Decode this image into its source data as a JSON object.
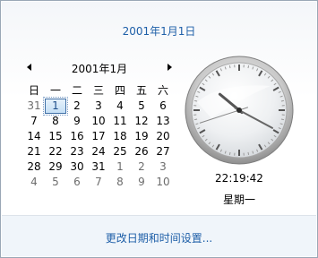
{
  "header": {
    "date": "2001年1月1日"
  },
  "calendar": {
    "month_label": "2001年1月",
    "weekdays": [
      "日",
      "一",
      "二",
      "三",
      "四",
      "五",
      "六"
    ],
    "weeks": [
      [
        {
          "d": "31",
          "o": true
        },
        {
          "d": "1",
          "sel": true
        },
        {
          "d": "2"
        },
        {
          "d": "3"
        },
        {
          "d": "4"
        },
        {
          "d": "5"
        },
        {
          "d": "6"
        }
      ],
      [
        {
          "d": "7"
        },
        {
          "d": "8"
        },
        {
          "d": "9"
        },
        {
          "d": "10"
        },
        {
          "d": "11"
        },
        {
          "d": "12"
        },
        {
          "d": "13"
        }
      ],
      [
        {
          "d": "14"
        },
        {
          "d": "15"
        },
        {
          "d": "16"
        },
        {
          "d": "17"
        },
        {
          "d": "18"
        },
        {
          "d": "19"
        },
        {
          "d": "20"
        }
      ],
      [
        {
          "d": "21"
        },
        {
          "d": "22"
        },
        {
          "d": "23"
        },
        {
          "d": "24"
        },
        {
          "d": "25"
        },
        {
          "d": "26"
        },
        {
          "d": "27"
        }
      ],
      [
        {
          "d": "28"
        },
        {
          "d": "29"
        },
        {
          "d": "30"
        },
        {
          "d": "31"
        },
        {
          "d": "1",
          "o": true
        },
        {
          "d": "2",
          "o": true
        },
        {
          "d": "3",
          "o": true
        }
      ],
      [
        {
          "d": "4",
          "o": true
        },
        {
          "d": "5",
          "o": true
        },
        {
          "d": "6",
          "o": true
        },
        {
          "d": "7",
          "o": true
        },
        {
          "d": "8",
          "o": true
        },
        {
          "d": "9",
          "o": true
        },
        {
          "d": "10",
          "o": true
        }
      ]
    ]
  },
  "clock": {
    "time": "22:19:42",
    "weekday": "星期一",
    "hour": 22,
    "minute": 19,
    "second": 42
  },
  "footer": {
    "settings_link": "更改日期和时间设置..."
  },
  "icons": {
    "prev": "chevron-left-icon",
    "next": "chevron-right-icon"
  },
  "colors": {
    "link": "#1e5fa8",
    "selected_border": "#3f6fa6",
    "other_month": "#6d6d6d"
  }
}
